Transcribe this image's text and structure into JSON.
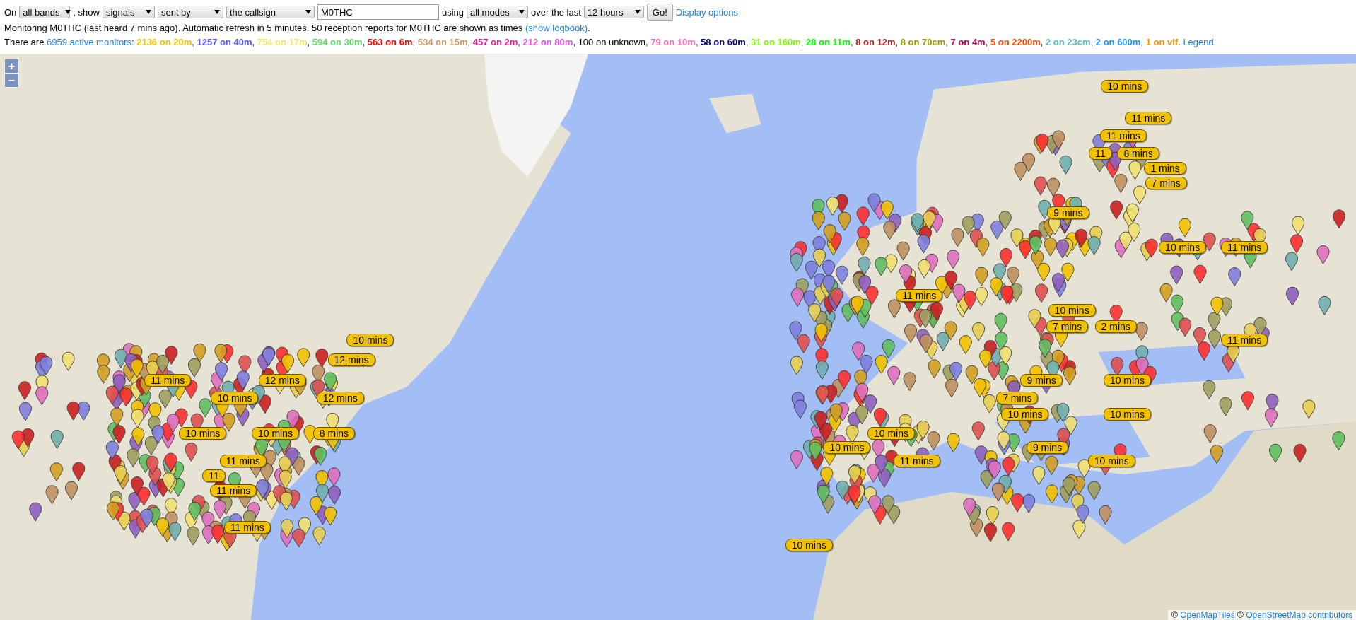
{
  "query": {
    "prefix": "On",
    "band": "all bands",
    "show_label": ", show",
    "what": "signals",
    "direction": "sent by",
    "target": "the callsign",
    "callsign": "M0THC",
    "using_label": "using",
    "mode": "all modes",
    "over_label": "over the last",
    "period": "12 hours",
    "go": "Go!",
    "options_link": "Display options"
  },
  "status": {
    "text": "Monitoring M0THC (last heard 7 mins ago). Automatic refresh in 5 minutes. 50 reception reports for M0THC are shown as times ",
    "link": "(show logbook)",
    "end": "."
  },
  "monitors": {
    "prefix": "There are ",
    "link": "6959 active monitors",
    "colon": ": ",
    "bands": [
      {
        "text": "2136 on 20m",
        "kind": "band",
        "color": "#f2c200"
      },
      {
        "text": "1257 on 40m",
        "kind": "band",
        "color": "#5a5aff"
      },
      {
        "text": "754 on 17m",
        "kind": "band",
        "color": "#f2e76a"
      },
      {
        "text": "594 on 30m",
        "kind": "band",
        "color": "#62d962"
      },
      {
        "text": "563 on 6m",
        "kind": "band",
        "color": "#ff0000"
      },
      {
        "text": "534 on 15m",
        "kind": "band",
        "color": "#cc9966"
      },
      {
        "text": "457 on 2m",
        "kind": "band",
        "color": "#ff1493"
      },
      {
        "text": "212 on 80m",
        "kind": "band",
        "color": "#e550e5"
      },
      {
        "text": "100 on unknown",
        "kind": "plain"
      },
      {
        "text": "79 on 10m",
        "kind": "band",
        "color": "#ff69b4"
      },
      {
        "text": "58 on 60m",
        "kind": "band",
        "color": "#000080"
      },
      {
        "text": "31 on 160m",
        "kind": "band",
        "color": "#7cfc00"
      },
      {
        "text": "28 on 11m",
        "kind": "band",
        "color": "#00ff00"
      },
      {
        "text": "8 on 12m",
        "kind": "band",
        "color": "#b22222"
      },
      {
        "text": "8 on 70cm",
        "kind": "band",
        "color": "#999900"
      },
      {
        "text": "7 on 4m",
        "kind": "band",
        "color": "#cc0044"
      },
      {
        "text": "5 on 2200m",
        "kind": "band",
        "color": "#ff4500"
      },
      {
        "text": "2 on 23cm",
        "kind": "band",
        "color": "#5fb7c0"
      },
      {
        "text": "2 on 600m",
        "kind": "band",
        "color": "#1e90ff"
      },
      {
        "text": "1 on vlf",
        "kind": "band",
        "color": "#ff8c00"
      }
    ],
    "separator": ", ",
    "end": ". ",
    "legend": "Legend"
  },
  "map": {
    "zoom_in": "+",
    "zoom_out": "−",
    "markers": [
      "10 mins",
      "11 mins",
      "11 mins",
      "11",
      "8 mins",
      "1 mins",
      "7 mins",
      "9 mins",
      "10 mins",
      "11 mins",
      "11 mins",
      "10 mins",
      "7 mins",
      "2 mins",
      "10 mins",
      "11 mins",
      "12 mins",
      "11 mins",
      "12 mins",
      "9 mins",
      "10 mins",
      "10 mins",
      "12 mins",
      "7 mins",
      "10 mins",
      "10 mins",
      "10 mins",
      "10 mins",
      "8 mins",
      "10 mins",
      "10 mins",
      "9 mins",
      "11 mins",
      "11 mins",
      "10 mins",
      "11",
      "11 mins",
      "11 mins",
      "10 mins"
    ],
    "attribution": {
      "copy1": "©",
      "link1": "OpenMapTiles",
      "copy2": "©",
      "link2": "OpenStreetMap contributors"
    }
  }
}
